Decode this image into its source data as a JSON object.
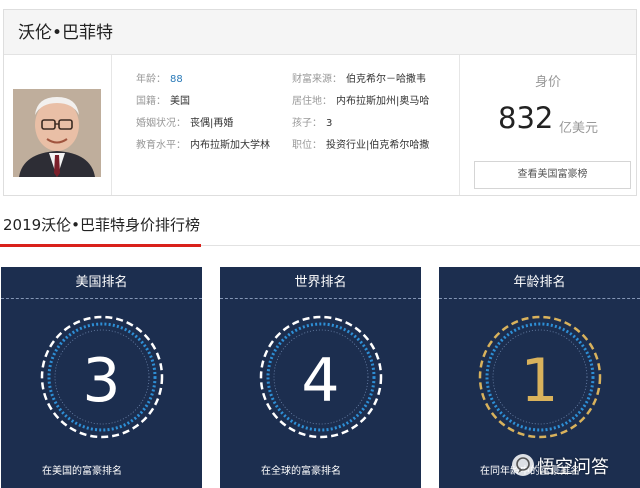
{
  "profile": {
    "name": "沃伦•巴菲特",
    "fields": [
      {
        "key": "年龄：",
        "value": "88"
      },
      {
        "key": "财富来源：",
        "value": "伯克希尔－哈撒韦"
      },
      {
        "key": "国籍：",
        "value": "美国"
      },
      {
        "key": "居住地：",
        "value": "内布拉斯加州|奥马哈"
      },
      {
        "key": "婚姻状况：",
        "value": "丧偶|再婚"
      },
      {
        "key": "孩子：",
        "value": "3"
      },
      {
        "key": "教育水平：",
        "value": "内布拉斯加大学林"
      },
      {
        "key": "职位：",
        "value": "投资行业|伯克希尔哈撒"
      }
    ],
    "worth_label": "身价",
    "worth_value": "832",
    "worth_unit": "亿美元",
    "rich_list_button": "查看美国富豪榜"
  },
  "section": {
    "title": "2019沃伦•巴菲特身价排行榜"
  },
  "rankings": [
    {
      "title": "美国排名",
      "rank": "3",
      "footer": "在美国的富豪排名",
      "color": "#ffffff"
    },
    {
      "title": "世界排名",
      "rank": "4",
      "footer": "在全球的富豪排名",
      "color": "#ffffff"
    },
    {
      "title": "年龄排名",
      "rank": "1",
      "footer": "在同年龄中的富豪排名",
      "color": "#d9b25c"
    }
  ],
  "colors": {
    "panel_bg": "#1c2e4f",
    "ring_blue": "#2e8fd6",
    "ring_gold": "#d9b25c",
    "accent_red": "#d9211b"
  },
  "watermark": {
    "text": "悟空问答",
    "icon": "chat-bubble-icon"
  }
}
